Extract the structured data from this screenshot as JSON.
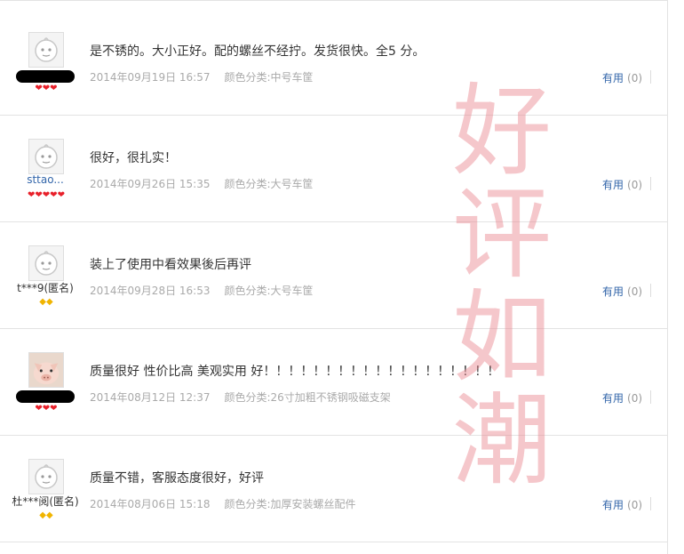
{
  "reviews": [
    {
      "username": "",
      "username_redacted": true,
      "badge": "❤❤❤",
      "badge_type": "heart",
      "content": "是不锈的。大小正好。配的螺丝不经拧。发货很快。全5 分。",
      "date": "2014年09月19日 16:57",
      "spec": "颜色分类:中号车筐",
      "useful_label": "有用",
      "useful_count": "(0)"
    },
    {
      "username": "sttao...",
      "username_redacted": false,
      "badge": "❤❤❤❤❤",
      "badge_type": "heart",
      "content": "很好，很扎实！",
      "date": "2014年09月26日 15:35",
      "spec": "颜色分类:大号车筐",
      "useful_label": "有用",
      "useful_count": "(0)"
    },
    {
      "username": "t***9(匿名)",
      "username_redacted": false,
      "badge": "◆◆",
      "badge_type": "gem",
      "content": "装上了使用中看效果後后再评",
      "date": "2014年09月28日 16:53",
      "spec": "颜色分类:大号车筐",
      "useful_label": "有用",
      "useful_count": "(0)"
    },
    {
      "username": "",
      "username_redacted": true,
      "badge": "❤❤❤",
      "badge_type": "heart",
      "content": "质量很好 性价比高 美观实用 好！！！！！！！！！！！！！！！！！！！",
      "date": "2014年08月12日 12:37",
      "spec": "颜色分类:26寸加粗不锈钢吸磁支架",
      "useful_label": "有用",
      "useful_count": "(0)"
    },
    {
      "username": "杜***阅(匿名)",
      "username_redacted": false,
      "badge": "◆◆",
      "badge_type": "gem",
      "content": "质量不错，客服态度很好，好评",
      "date": "2014年08月06日 15:18",
      "spec": "颜色分类:加厚安装螺丝配件",
      "useful_label": "有用",
      "useful_count": "(0)"
    }
  ],
  "watermark": [
    "好",
    "评",
    "如",
    "潮"
  ],
  "colors": {
    "link": "#3366aa",
    "meta": "#aaaaaa",
    "heart": "#e8202a",
    "gem": "#f0b400",
    "watermark": "#e8828c"
  }
}
